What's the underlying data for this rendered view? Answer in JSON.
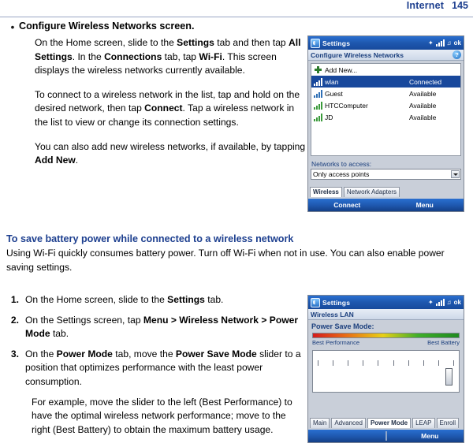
{
  "header": {
    "title": "Internet",
    "page_number": "145"
  },
  "bullet": {
    "dot": "•",
    "lead_bold": "Configure Wireless Networks screen",
    "lead_tail": ".",
    "paragraphs": [
      "On the Home screen, slide to the <b>Settings</b> tab and then tap <b>All Settings</b>. In the <b>Connections</b> tab, tap <b>Wi-Fi</b>. This screen displays the wireless networks currently available.",
      "To connect to a wireless network in the list, tap and hold on the desired network, then tap <b>Connect</b>. Tap a wireless network in the list to view or change its connection settings.",
      "You can also add new wireless networks, if available, by tapping <b>Add New</b>."
    ]
  },
  "section": {
    "heading": "To save battery power while connected to a wireless network",
    "body": "Using Wi-Fi quickly consumes battery power. Turn off Wi-Fi when not in use. You can also enable power saving settings.",
    "steps": [
      {
        "n": "1.",
        "html": "On the Home screen, slide to the <b>Settings</b> tab."
      },
      {
        "n": "2.",
        "html": "On the Settings screen, tap <b>Menu &gt; Wireless Network &gt; Power Mode</b> tab."
      },
      {
        "n": "3.",
        "html": "On the <b>Power Mode</b> tab, move the <b>Power Save Mode</b> slider to a position that optimizes performance with the least power consumption."
      }
    ],
    "closing": "For example, move the slider to the left (Best Performance) to have the optimal wireless network performance; move to the right (Best Battery) to obtain the maximum battery usage."
  },
  "device_top": {
    "titlebar": {
      "app": "Settings",
      "ok": "ok"
    },
    "subhead": {
      "title": "Configure Wireless Networks",
      "help": "?"
    },
    "add_new": "Add New...",
    "networks": [
      {
        "name": "wlan",
        "status": "Connected",
        "selected": true
      },
      {
        "name": "Guest",
        "status": "Available",
        "selected": false
      },
      {
        "name": "HTCComputer",
        "status": "Available",
        "selected": false
      },
      {
        "name": "JD",
        "status": "Available",
        "selected": false
      }
    ],
    "access_label": "Networks to access:",
    "access_value": "Only access points",
    "tabs": [
      {
        "label": "Wireless",
        "active": true
      },
      {
        "label": "Network Adapters",
        "active": false
      }
    ],
    "softkeys": {
      "left": "Connect",
      "right": "Menu"
    }
  },
  "device_bottom": {
    "titlebar": {
      "app": "Settings",
      "ok": "ok"
    },
    "subhead": {
      "title": "Wireless LAN"
    },
    "power_title": "Power Save Mode:",
    "scale_left": "Best Performance",
    "scale_right": "Best Battery",
    "tabs": [
      {
        "label": "Main",
        "active": false
      },
      {
        "label": "Advanced",
        "active": false
      },
      {
        "label": "Power Mode",
        "active": true
      },
      {
        "label": "LEAP",
        "active": false
      },
      {
        "label": "Enroll",
        "active": false
      }
    ],
    "softkeys": {
      "right": "Menu"
    }
  },
  "colors": {
    "accent_blue": "#1d3f8f",
    "titlebar_blue": "#1e57ae",
    "selection_blue": "#18489c"
  }
}
